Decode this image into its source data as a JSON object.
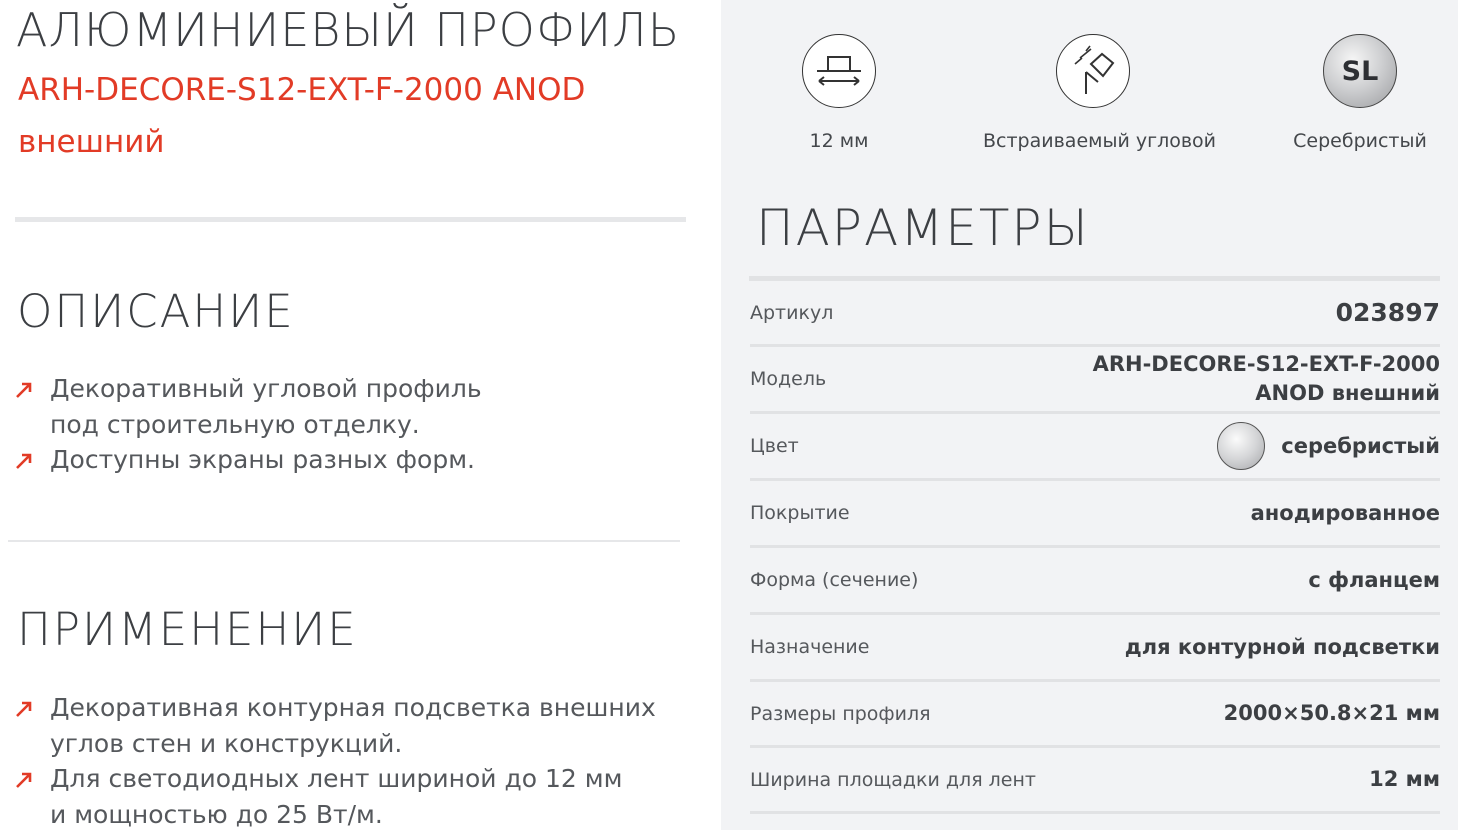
{
  "product": {
    "title": "АЛЮМИНИЕВЫЙ ПРОФИЛЬ",
    "subtitle_line1": "ARH-DECORE-S12-EXT-F-2000 ANOD",
    "subtitle_line2": "внешний"
  },
  "description": {
    "heading": "ОПИСАНИЕ",
    "items": [
      {
        "line1": "Декоративный угловой профиль",
        "line2": "под строительную отделку."
      },
      {
        "line1": "Доступны экраны разных форм.",
        "line2": ""
      }
    ]
  },
  "application": {
    "heading": "ПРИМЕНЕНИЕ",
    "items": [
      {
        "line1": "Декоративная контурная подсветка внешних",
        "line2": "углов стен и конструкций."
      },
      {
        "line1": "Для светодиодных лент шириной до 12 мм",
        "line2": "и мощностью до 25 Вт/м."
      }
    ]
  },
  "features": [
    {
      "icon": "width-icon",
      "label": "12 мм"
    },
    {
      "icon": "corner-recessed-icon",
      "label": "Встраиваемый угловой"
    },
    {
      "icon": "color-sl-icon",
      "text": "SL",
      "label": "Серебристый"
    }
  ],
  "parameters": {
    "heading": "ПАРАМЕТРЫ",
    "rows": [
      {
        "label": "Артикул",
        "value": "023897"
      },
      {
        "label": "Модель",
        "value_line1": "ARH-DECORE-S12-EXT-F-2000",
        "value_line2": "ANOD внешний"
      },
      {
        "label": "Цвет",
        "value": "серебристый"
      },
      {
        "label": "Покрытие",
        "value": "анодированное"
      },
      {
        "label": "Форма (сечение)",
        "value": "с фланцем"
      },
      {
        "label": "Назначение",
        "value": "для контурной подсветки"
      },
      {
        "label": "Размеры профиля",
        "value": "2000×50.8×21 мм"
      },
      {
        "label": "Ширина площадки для лент",
        "value": "12 мм"
      }
    ]
  },
  "colors": {
    "accent": "#e23b26",
    "heading": "#3c3f43",
    "panel_bg": "#f2f3f5"
  }
}
